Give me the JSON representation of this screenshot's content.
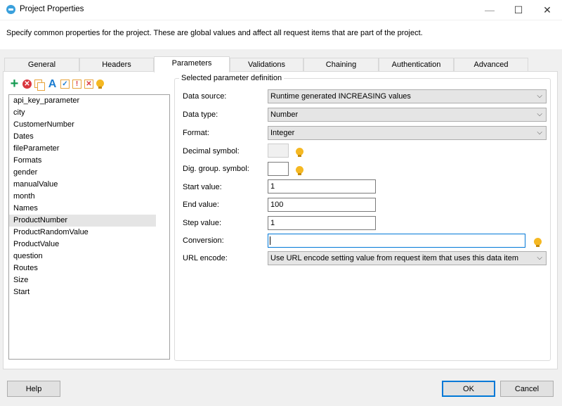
{
  "window": {
    "title": "Project Properties"
  },
  "description": "Specify common properties for the project. These are global values and affect all request items that are part of the project.",
  "tabs": [
    {
      "label": "General"
    },
    {
      "label": "Headers"
    },
    {
      "label": "Parameters"
    },
    {
      "label": "Validations"
    },
    {
      "label": "Chaining"
    },
    {
      "label": "Authentication"
    },
    {
      "label": "Advanced"
    }
  ],
  "active_tab": "Parameters",
  "toolbar_icons": [
    "add-icon",
    "delete-icon",
    "copy-icon",
    "rename-icon",
    "check-icon",
    "warning-icon",
    "remove-icon",
    "hint-icon"
  ],
  "parameters": {
    "items": [
      "api_key_parameter",
      "city",
      "CustomerNumber",
      "Dates",
      "fileParameter",
      "Formats",
      "gender",
      "manualValue",
      "month",
      "Names",
      "ProductNumber",
      "ProductRandomValue",
      "ProductValue",
      "question",
      "Routes",
      "Size",
      "Start"
    ],
    "selected": "ProductNumber"
  },
  "definition": {
    "group_title": "Selected parameter definition",
    "data_source": {
      "label": "Data source:",
      "value": "Runtime generated INCREASING values"
    },
    "data_type": {
      "label": "Data type:",
      "value": "Number"
    },
    "format": {
      "label": "Format:",
      "value": "Integer"
    },
    "decimal_symbol": {
      "label": "Decimal symbol:",
      "value": ""
    },
    "dig_group_symbol": {
      "label": "Dig. group. symbol:",
      "value": ""
    },
    "start_value": {
      "label": "Start value:",
      "value": "1"
    },
    "end_value": {
      "label": "End value:",
      "value": "100"
    },
    "step_value": {
      "label": "Step value:",
      "value": "1"
    },
    "conversion": {
      "label": "Conversion:",
      "value": ""
    },
    "url_encode": {
      "label": "URL encode:",
      "value": "Use URL encode setting value from request item that uses this data item"
    }
  },
  "footer": {
    "help_label": "Help",
    "ok_label": "OK",
    "cancel_label": "Cancel"
  },
  "colors": {
    "accent": "#0078d7",
    "add_icon": "#139a51",
    "delete_icon": "#d9363e",
    "hint_icon": "#f5b822"
  }
}
